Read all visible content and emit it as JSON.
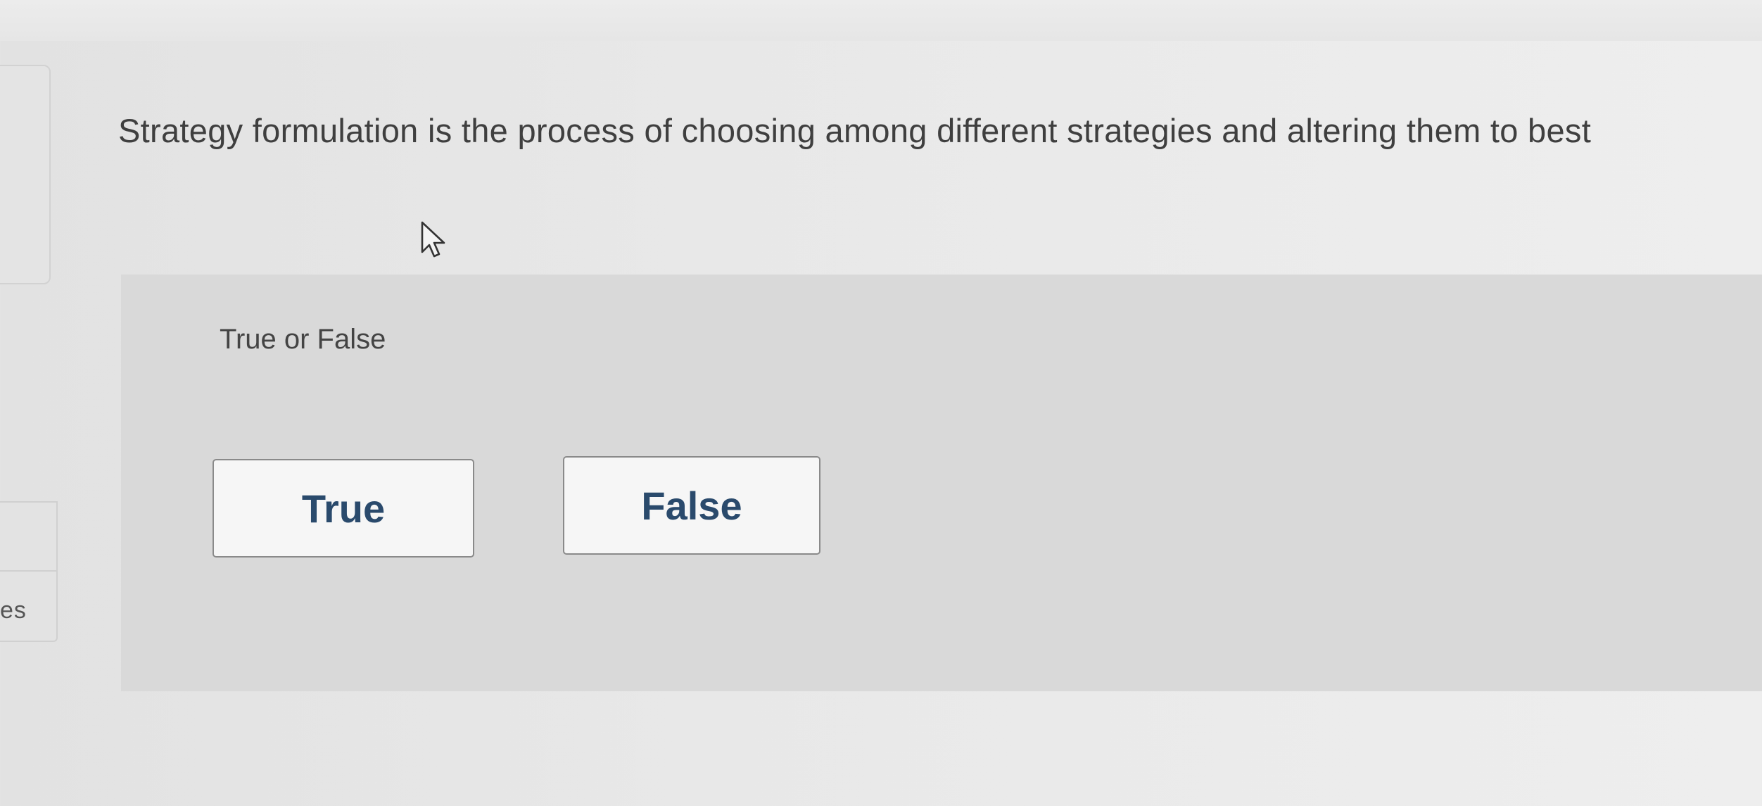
{
  "sidebar": {
    "partial_label": "es"
  },
  "question": {
    "text": "Strategy formulation is the process of choosing among different strategies and altering them to best"
  },
  "answer_panel": {
    "label": "True or False",
    "options": [
      {
        "label": "True"
      },
      {
        "label": "False"
      }
    ]
  },
  "colors": {
    "button_text": "#2a4a6c",
    "panel_background": "#d9d9d9",
    "page_background": "#e8e8e8"
  },
  "icons": {
    "cursor": "mouse-pointer-icon"
  }
}
